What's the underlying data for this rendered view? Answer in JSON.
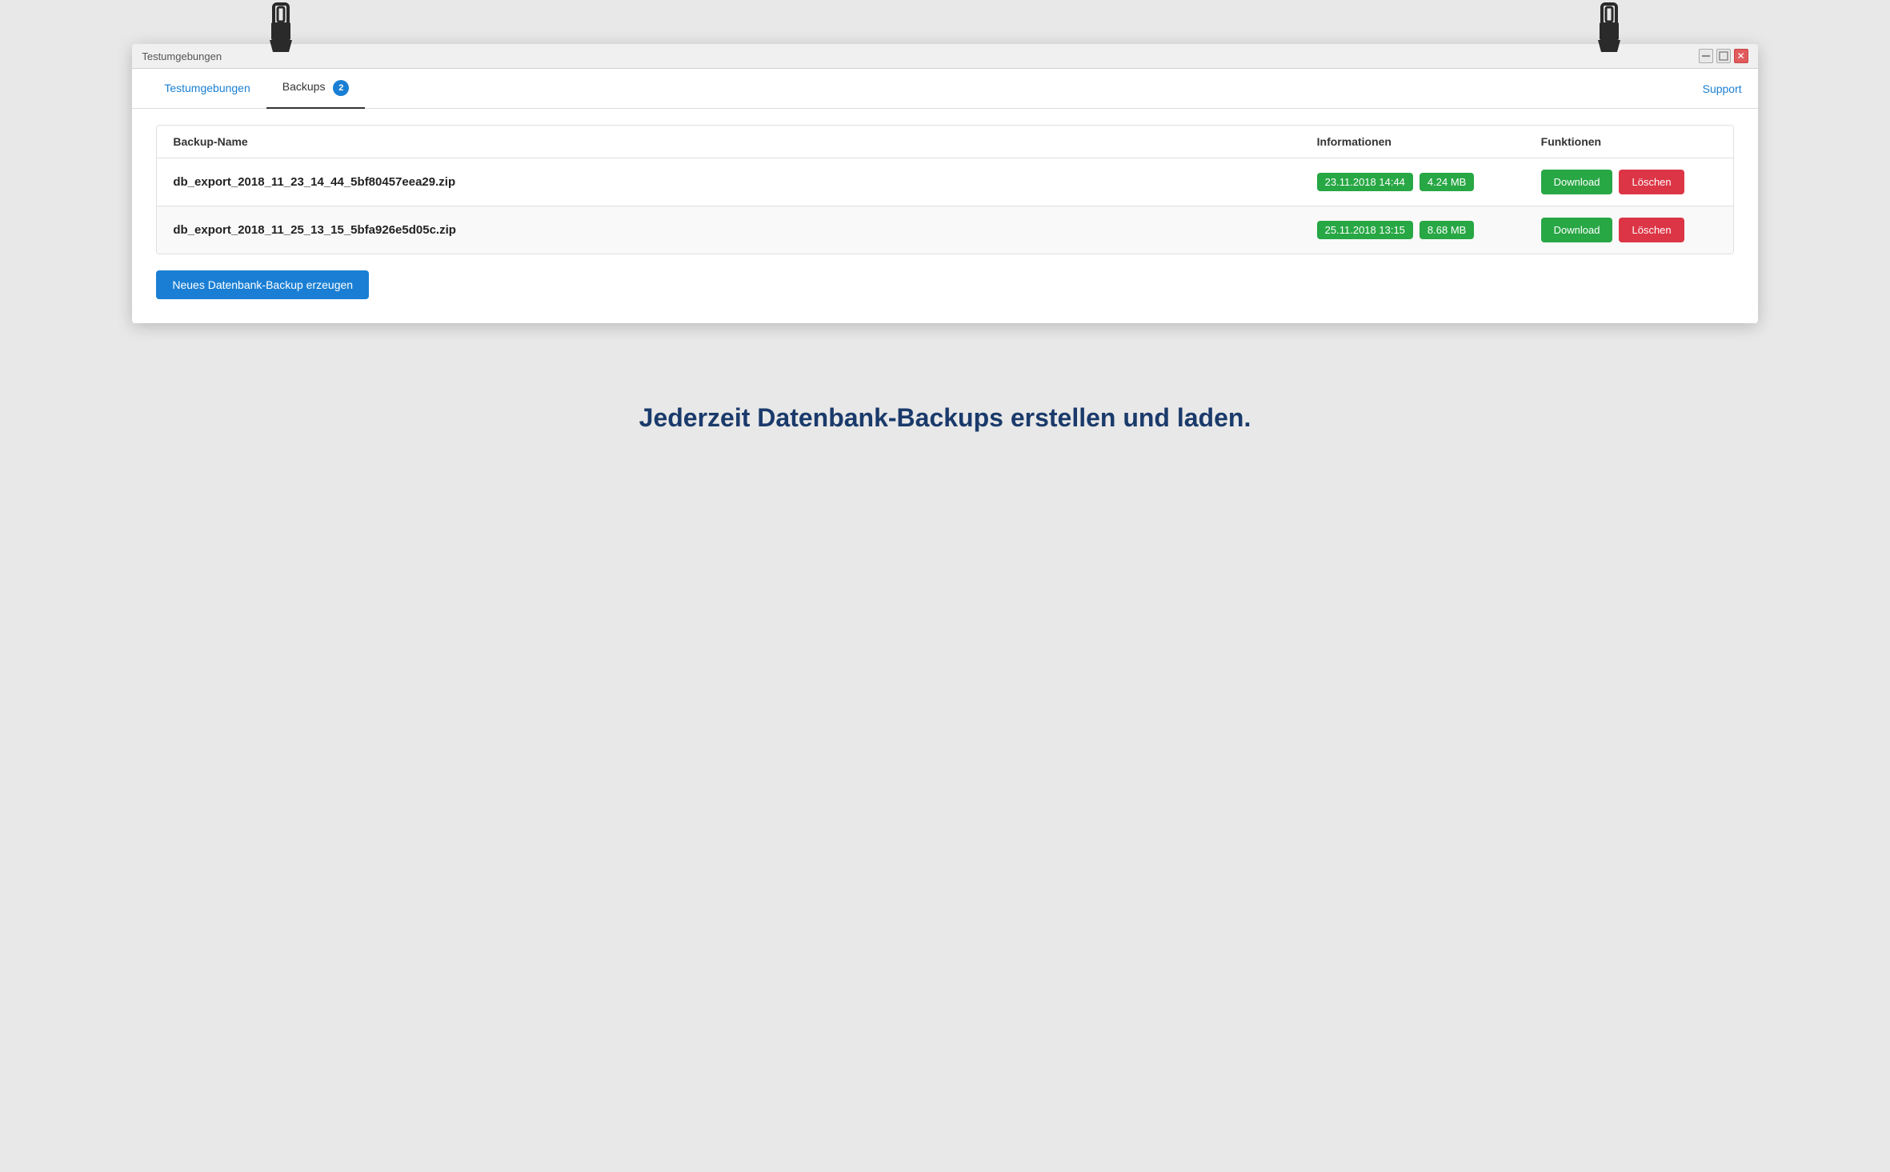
{
  "window": {
    "title": "Testumgebungen",
    "controls": {
      "minimize": "🗕",
      "maximize": "🗖",
      "close": "✕"
    }
  },
  "tabs": {
    "items": [
      {
        "id": "testumgebungen",
        "label": "Testumgebungen",
        "active": false,
        "badge": null
      },
      {
        "id": "backups",
        "label": "Backups",
        "active": true,
        "badge": "2"
      }
    ],
    "support_label": "Support"
  },
  "table": {
    "headers": {
      "name": "Backup-Name",
      "info": "Informationen",
      "actions": "Funktionen"
    },
    "rows": [
      {
        "name": "db_export_2018_11_23_14_44_5bf80457eea29.zip",
        "date": "23.11.2018 14:44",
        "size": "4.24 MB",
        "download_label": "Download",
        "delete_label": "Löschen"
      },
      {
        "name": "db_export_2018_11_25_13_15_5bfa926e5d05c.zip",
        "date": "25.11.2018 13:15",
        "size": "8.68 MB",
        "download_label": "Download",
        "delete_label": "Löschen"
      }
    ],
    "new_backup_label": "Neues Datenbank-Backup erzeugen"
  },
  "tagline": "Jederzeit Datenbank-Backups erstellen und laden.",
  "colors": {
    "primary_blue": "#1a7fd4",
    "dark_blue": "#1a3a6b",
    "green": "#28a745",
    "red": "#dc3545"
  }
}
